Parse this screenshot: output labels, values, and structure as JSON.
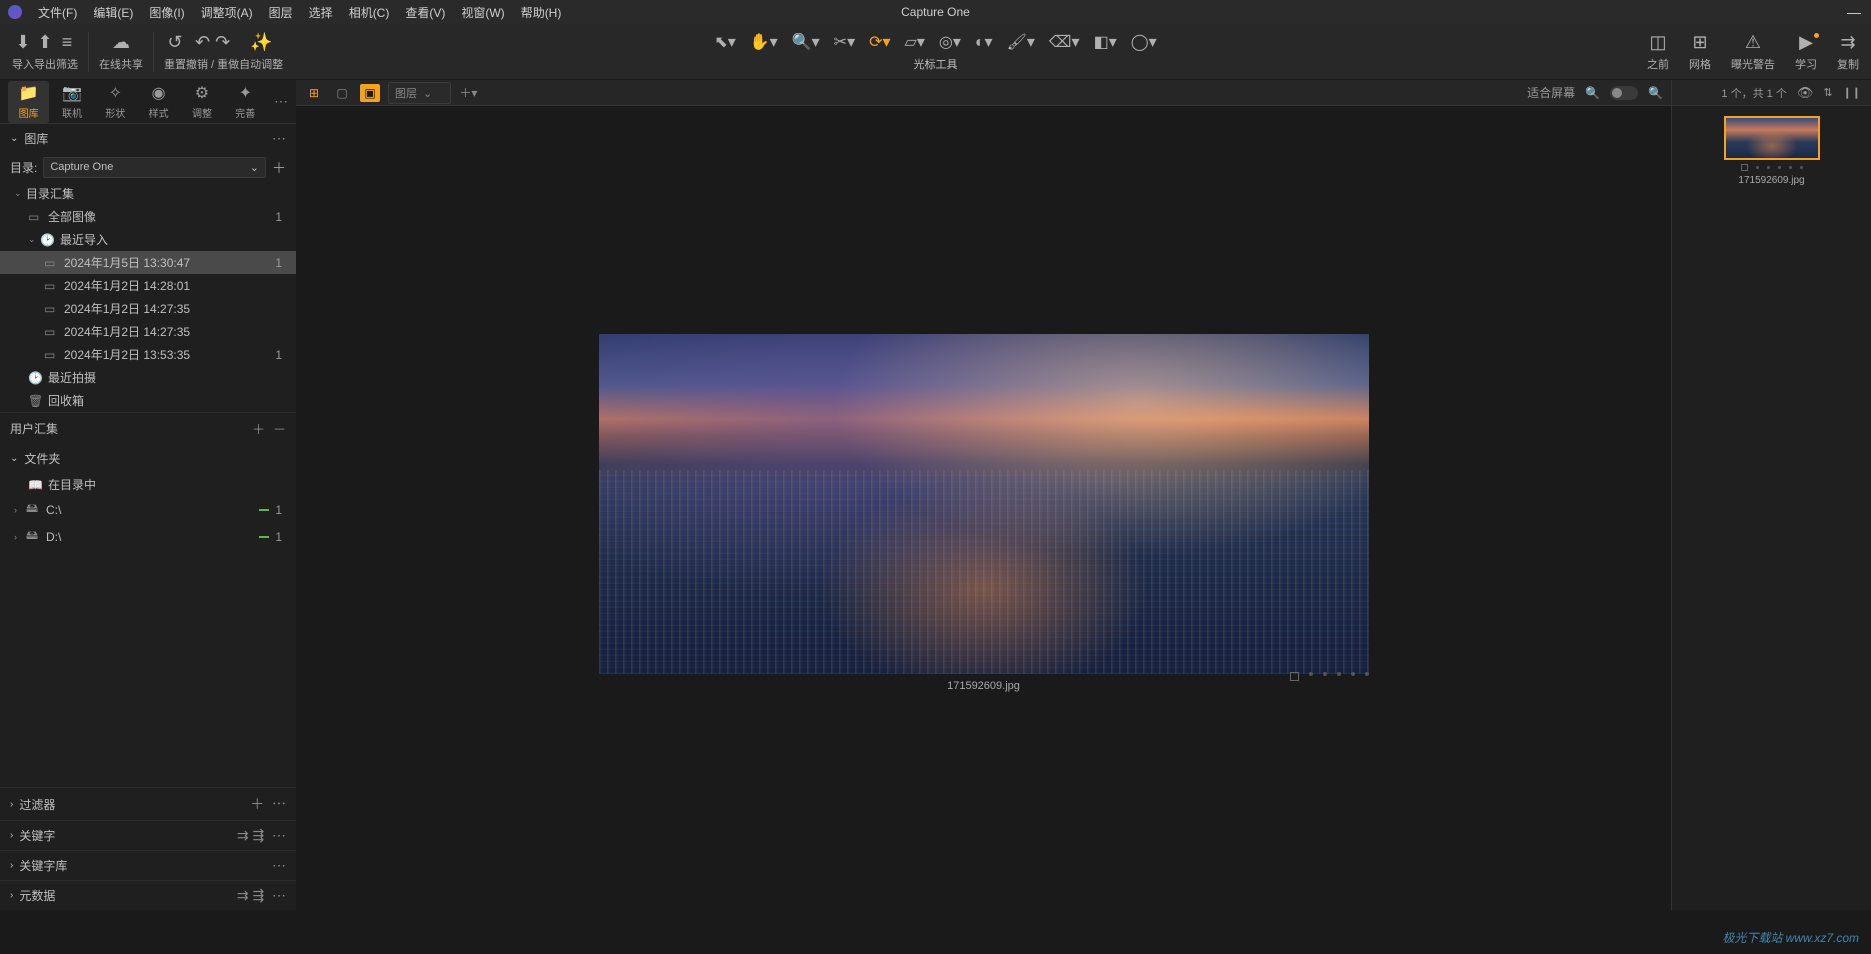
{
  "app": {
    "title": "Capture One"
  },
  "menu": {
    "items": [
      {
        "label": "文件(F)"
      },
      {
        "label": "编辑(E)"
      },
      {
        "label": "图像(I)"
      },
      {
        "label": "调整项(A)"
      },
      {
        "label": "图层"
      },
      {
        "label": "选择"
      },
      {
        "label": "相机(C)"
      },
      {
        "label": "查看(V)"
      },
      {
        "label": "视窗(W)"
      },
      {
        "label": "帮助(H)"
      }
    ]
  },
  "toolbar": {
    "import": "导入",
    "export": "导出",
    "filter": "筛选",
    "share": "在线共享",
    "reset": "重置",
    "undo_redo": "撤销 / 重做",
    "auto": "自动调整",
    "cursor_label": "光标工具",
    "before": "之前",
    "grid": "网格",
    "exposure_warn": "曝光警告",
    "learn": "学习",
    "copy": "复制"
  },
  "tooltabs": {
    "items": [
      {
        "label": "图库",
        "icon": "folder"
      },
      {
        "label": "联机",
        "icon": "camera"
      },
      {
        "label": "形状",
        "icon": "shape"
      },
      {
        "label": "样式",
        "icon": "style"
      },
      {
        "label": "调整",
        "icon": "adjust"
      },
      {
        "label": "完善",
        "icon": "refine"
      }
    ]
  },
  "library": {
    "panel_title": "图库",
    "catalog_label": "目录:",
    "catalog_value": "Capture One",
    "summary_title": "目录汇集",
    "all_images": {
      "label": "全部图像",
      "count": "1"
    },
    "recent_import": "最近导入",
    "imports": [
      {
        "label": "2024年1月5日  13:30:47",
        "count": "1",
        "selected": true
      },
      {
        "label": "2024年1月2日  14:28:01"
      },
      {
        "label": "2024年1月2日  14:27:35"
      },
      {
        "label": "2024年1月2日  14:27:35"
      },
      {
        "label": "2024年1月2日  13:53:35",
        "count": "1"
      }
    ],
    "recent_capture": "最近拍摄",
    "trash": "回收箱",
    "user_collection": "用户汇集",
    "folders_title": "文件夹",
    "in_catalog": "在目录中",
    "drives": [
      {
        "label": "C:\\",
        "count": "1"
      },
      {
        "label": "D:\\",
        "count": "1"
      }
    ],
    "filter": "过滤器",
    "keywords": "关键字",
    "keyword_lib": "关键字库",
    "metadata": "元数据"
  },
  "viewer": {
    "layer_label": "图层",
    "fit_label": "适合屏幕",
    "image_name": "171592609.jpg"
  },
  "browser": {
    "count_text": "1 个，共 1 个",
    "thumb_name": "171592609.jpg"
  },
  "watermark": "极光下载站 www.xz7.com"
}
